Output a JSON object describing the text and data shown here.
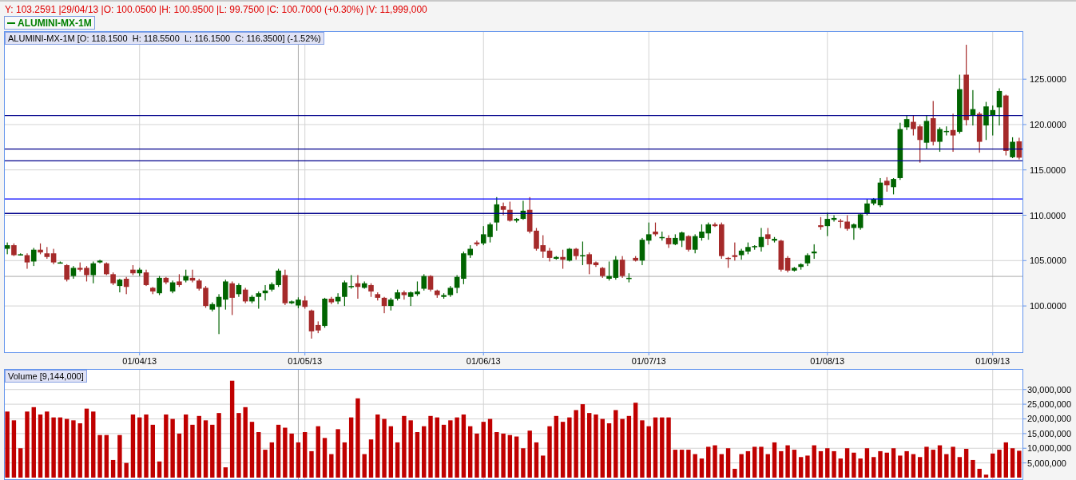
{
  "status_line": "Y: 103.2591 |29/04/13 |O: 100.0500 |H: 100.9500 |L: 99.7500 |C: 100.7000 (+0.30%) |V: 11,999,000",
  "legend": {
    "label": "ALUMINI-MX-1M"
  },
  "price_panel": {
    "info_label": "ALUMINI-MX-1M [O: 118.1500  H: 118.5500  L: 116.1500  C: 116.3500] (-1.52%)",
    "chart_data": {
      "type": "candlestick",
      "grid": true,
      "ylim": [
        94.9,
        130.3
      ],
      "categories": [
        null,
        null,
        null,
        null,
        null,
        null,
        null,
        null,
        null,
        null,
        null,
        null,
        null,
        null,
        null,
        null,
        null,
        null,
        null,
        null,
        "01/04/13",
        null,
        null,
        null,
        null,
        null,
        null,
        null,
        null,
        null,
        null,
        null,
        null,
        null,
        null,
        null,
        null,
        null,
        null,
        null,
        null,
        null,
        null,
        null,
        null,
        "01/05/13",
        null,
        null,
        null,
        null,
        null,
        null,
        null,
        null,
        null,
        null,
        null,
        null,
        null,
        null,
        null,
        null,
        null,
        null,
        null,
        null,
        null,
        null,
        null,
        null,
        null,
        null,
        "01/06/13",
        null,
        null,
        null,
        null,
        null,
        null,
        null,
        null,
        null,
        null,
        null,
        null,
        null,
        null,
        null,
        null,
        null,
        null,
        null,
        null,
        null,
        null,
        null,
        null,
        "01/07/13",
        null,
        null,
        null,
        null,
        null,
        null,
        null,
        null,
        null,
        null,
        null,
        null,
        null,
        null,
        null,
        null,
        null,
        null,
        null,
        null,
        null,
        null,
        null,
        null,
        null,
        null,
        "01/08/13",
        null,
        null,
        null,
        null,
        null,
        null,
        null,
        null,
        null,
        null,
        null,
        null,
        null,
        null,
        null,
        null,
        null,
        null,
        null,
        null,
        null,
        null,
        null,
        null,
        "01/09/13",
        null,
        null,
        null,
        null
      ],
      "yticks": [
        {
          "value": 100,
          "label": "100.0000"
        },
        {
          "value": 105,
          "label": "105.0000"
        },
        {
          "value": 110,
          "label": "110.0000"
        },
        {
          "value": 115,
          "label": "115.0000"
        },
        {
          "value": 120,
          "label": "120.0000"
        },
        {
          "value": 125,
          "label": "125.0000"
        }
      ],
      "ohlc": [
        [
          106.3,
          107.0,
          105.7,
          106.7
        ],
        [
          106.7,
          106.9,
          105.5,
          105.6
        ],
        [
          105.7,
          105.8,
          105.6,
          105.7
        ],
        [
          105.6,
          105.8,
          104.1,
          104.8
        ],
        [
          104.9,
          106.4,
          104.4,
          106.2
        ],
        [
          106.2,
          106.9,
          105.7,
          105.9
        ],
        [
          105.8,
          106.5,
          105.2,
          105.4
        ],
        [
          105.8,
          106.3,
          104.6,
          104.8
        ],
        [
          104.8,
          104.9,
          104.7,
          104.8
        ],
        [
          104.5,
          104.6,
          102.7,
          102.9
        ],
        [
          103.3,
          104.4,
          103.0,
          104.2
        ],
        [
          104.2,
          104.8,
          103.8,
          104.0
        ],
        [
          104.2,
          104.4,
          102.7,
          103.4
        ],
        [
          103.4,
          104.9,
          102.5,
          104.7
        ],
        [
          104.8,
          105.1,
          104.7,
          105.0
        ],
        [
          104.7,
          104.8,
          103.4,
          103.5
        ],
        [
          103.5,
          103.7,
          102.3,
          102.5
        ],
        [
          102.2,
          103.0,
          101.5,
          102.9
        ],
        [
          103.0,
          103.2,
          101.3,
          102.1
        ],
        [
          104.0,
          104.5,
          103.4,
          103.6
        ],
        [
          103.6,
          104.2,
          103.3,
          104.0
        ],
        [
          103.7,
          104.0,
          102.2,
          102.3
        ],
        [
          102.0,
          102.1,
          101.3,
          101.6
        ],
        [
          101.4,
          103.3,
          101.2,
          103.1
        ],
        [
          103.1,
          103.2,
          102.4,
          102.6
        ],
        [
          101.6,
          102.8,
          101.4,
          102.6
        ],
        [
          102.7,
          103.5,
          102.1,
          102.3
        ],
        [
          102.8,
          104.0,
          102.6,
          103.3
        ],
        [
          103.1,
          104.0,
          102.6,
          102.8
        ],
        [
          102.8,
          103.0,
          101.7,
          101.9
        ],
        [
          102.0,
          102.2,
          99.8,
          100.0
        ],
        [
          99.6,
          100.4,
          99.4,
          100.2
        ],
        [
          99.9,
          101.3,
          96.9,
          101.0
        ],
        [
          100.7,
          102.9,
          99.6,
          102.7
        ],
        [
          102.5,
          102.7,
          99.0,
          100.9
        ],
        [
          101.3,
          102.5,
          101.0,
          102.3
        ],
        [
          101.8,
          102.0,
          100.3,
          100.5
        ],
        [
          100.5,
          101.2,
          100.3,
          101.0
        ],
        [
          101.0,
          101.6,
          99.7,
          101.4
        ],
        [
          101.4,
          102.3,
          100.6,
          101.7
        ],
        [
          101.8,
          102.6,
          101.6,
          102.4
        ],
        [
          102.3,
          104.1,
          102.1,
          103.9
        ],
        [
          103.4,
          104.0,
          100.1,
          100.3
        ],
        [
          100.3,
          100.6,
          100.2,
          100.5
        ],
        [
          100.05,
          100.95,
          99.75,
          100.7
        ],
        [
          100.6,
          101.1,
          99.7,
          99.9
        ],
        [
          99.5,
          99.6,
          96.4,
          97.2
        ],
        [
          97.9,
          98.3,
          97.0,
          97.3
        ],
        [
          97.8,
          100.9,
          97.6,
          100.8
        ],
        [
          100.8,
          101.0,
          100.2,
          100.4
        ],
        [
          100.5,
          101.4,
          100.2,
          101.0
        ],
        [
          101.0,
          102.8,
          100.0,
          102.6
        ],
        [
          102.2,
          103.4,
          101.9,
          102.2
        ],
        [
          102.5,
          103.4,
          100.8,
          102.1
        ],
        [
          102.0,
          102.7,
          101.9,
          102.5
        ],
        [
          102.3,
          102.5,
          101.0,
          101.6
        ],
        [
          101.3,
          101.5,
          100.6,
          100.9
        ],
        [
          100.9,
          101.0,
          99.2,
          100.0
        ],
        [
          100.0,
          100.9,
          99.5,
          100.7
        ],
        [
          100.8,
          101.8,
          100.6,
          101.5
        ],
        [
          101.5,
          101.7,
          100.7,
          101.2
        ],
        [
          101.0,
          101.6,
          100.0,
          101.5
        ],
        [
          101.3,
          102.7,
          101.1,
          101.6
        ],
        [
          101.9,
          103.5,
          101.7,
          103.3
        ],
        [
          103.3,
          103.4,
          101.6,
          101.8
        ],
        [
          101.7,
          101.8,
          100.9,
          101.2
        ],
        [
          101.0,
          101.4,
          100.8,
          101.2
        ],
        [
          101.2,
          102.2,
          101.0,
          102.0
        ],
        [
          102.0,
          103.4,
          101.4,
          103.2
        ],
        [
          103.0,
          106.0,
          102.4,
          105.8
        ],
        [
          105.6,
          106.7,
          105.3,
          106.3
        ],
        [
          107.0,
          107.2,
          106.6,
          106.8
        ],
        [
          106.9,
          108.8,
          106.7,
          107.9
        ],
        [
          107.6,
          109.2,
          107.0,
          109.0
        ],
        [
          109.2,
          112.0,
          108.3,
          111.2
        ],
        [
          111.0,
          111.4,
          110.0,
          110.6
        ],
        [
          110.6,
          111.5,
          109.3,
          109.4
        ],
        [
          109.4,
          109.7,
          109.2,
          109.6
        ],
        [
          109.6,
          111.6,
          109.5,
          110.5
        ],
        [
          110.6,
          112.0,
          108.0,
          108.2
        ],
        [
          108.3,
          108.6,
          106.1,
          106.3
        ],
        [
          106.7,
          107.8,
          105.3,
          106.0
        ],
        [
          106.1,
          106.4,
          104.9,
          105.3
        ],
        [
          105.2,
          105.5,
          105.1,
          105.4
        ],
        [
          105.4,
          106.2,
          104.1,
          105.1
        ],
        [
          105.0,
          106.4,
          104.9,
          106.3
        ],
        [
          106.3,
          106.4,
          105.1,
          105.5
        ],
        [
          105.6,
          107.1,
          104.5,
          105.6
        ],
        [
          105.7,
          105.9,
          103.5,
          104.6
        ],
        [
          104.8,
          104.9,
          104.3,
          104.5
        ],
        [
          104.2,
          104.3,
          103.1,
          103.3
        ],
        [
          103.0,
          104.9,
          102.8,
          103.3
        ],
        [
          103.1,
          105.5,
          102.9,
          105.1
        ],
        [
          105.1,
          105.5,
          103.1,
          103.3
        ],
        [
          103.1,
          103.6,
          102.6,
          103.1
        ],
        [
          105.3,
          105.5,
          104.9,
          105.0
        ],
        [
          105.0,
          107.5,
          104.5,
          107.3
        ],
        [
          107.2,
          109.2,
          106.8,
          107.9
        ],
        [
          108.2,
          109.2,
          107.7,
          107.9
        ],
        [
          107.6,
          108.2,
          107.2,
          107.6
        ],
        [
          107.5,
          107.8,
          106.4,
          106.8
        ],
        [
          106.8,
          107.9,
          106.7,
          107.5
        ],
        [
          107.2,
          108.2,
          106.5,
          108.1
        ],
        [
          107.7,
          107.8,
          106.0,
          106.2
        ],
        [
          106.2,
          107.9,
          105.8,
          107.7
        ],
        [
          107.5,
          109.0,
          107.2,
          108.2
        ],
        [
          108.0,
          109.2,
          107.3,
          109.0
        ],
        [
          109.0,
          109.2,
          108.7,
          108.8
        ],
        [
          109.0,
          109.2,
          105.2,
          105.5
        ],
        [
          105.3,
          105.4,
          104.2,
          105.2
        ],
        [
          105.6,
          107.0,
          105.0,
          105.4
        ],
        [
          105.6,
          106.3,
          105.1,
          106.1
        ],
        [
          106.0,
          107.0,
          105.7,
          106.5
        ],
        [
          106.5,
          106.7,
          106.2,
          106.6
        ],
        [
          106.5,
          108.6,
          106.0,
          107.6
        ],
        [
          107.9,
          108.6,
          106.7,
          107.4
        ],
        [
          107.2,
          107.6,
          107.0,
          107.4
        ],
        [
          107.2,
          107.3,
          103.8,
          104.0
        ],
        [
          105.3,
          105.5,
          103.7,
          103.9
        ],
        [
          103.9,
          104.3,
          103.8,
          104.2
        ],
        [
          104.3,
          104.7,
          104.0,
          104.6
        ],
        [
          104.7,
          105.8,
          104.4,
          105.6
        ],
        [
          105.8,
          106.8,
          105.2,
          106.0
        ],
        [
          108.9,
          109.8,
          108.4,
          108.7
        ],
        [
          108.8,
          110.3,
          107.7,
          109.6
        ],
        [
          109.5,
          110.0,
          109.3,
          109.7
        ],
        [
          109.4,
          109.6,
          108.6,
          109.3
        ],
        [
          109.3,
          110.0,
          108.3,
          108.5
        ],
        [
          108.6,
          109.1,
          107.3,
          109.0
        ],
        [
          108.6,
          110.2,
          108.4,
          110.1
        ],
        [
          110.2,
          111.8,
          110.0,
          111.3
        ],
        [
          111.3,
          111.9,
          111.1,
          111.8
        ],
        [
          111.1,
          114.1,
          110.9,
          113.6
        ],
        [
          113.8,
          114.2,
          112.6,
          113.3
        ],
        [
          113.1,
          114.1,
          112.3,
          114.0
        ],
        [
          114.1,
          120.2,
          113.9,
          119.5
        ],
        [
          119.7,
          121.0,
          119.4,
          120.6
        ],
        [
          120.3,
          121.0,
          118.8,
          119.5
        ],
        [
          119.8,
          120.0,
          115.8,
          118.3
        ],
        [
          118.0,
          121.0,
          117.3,
          120.4
        ],
        [
          120.7,
          122.6,
          117.7,
          118.1
        ],
        [
          118.1,
          119.7,
          117.0,
          119.5
        ],
        [
          119.3,
          119.8,
          118.8,
          119.3
        ],
        [
          119.4,
          121.2,
          117.0,
          118.8
        ],
        [
          119.2,
          125.5,
          119.0,
          123.9
        ],
        [
          125.5,
          128.8,
          119.9,
          120.5
        ],
        [
          121.0,
          123.8,
          119.9,
          121.7
        ],
        [
          121.2,
          121.4,
          116.9,
          118.1
        ],
        [
          119.9,
          122.5,
          118.3,
          122.0
        ],
        [
          121.0,
          122.1,
          118.8,
          121.6
        ],
        [
          121.9,
          124.0,
          119.9,
          123.7
        ],
        [
          123.2,
          123.3,
          116.6,
          117.1
        ],
        [
          116.4,
          118.6,
          116.3,
          118.1
        ],
        [
          118.15,
          118.55,
          116.15,
          116.35
        ]
      ],
      "ref_lines": [
        {
          "axis": "y",
          "value": 121.0,
          "color": "#00008b"
        },
        {
          "axis": "y",
          "value": 117.3,
          "color": "#00008b"
        },
        {
          "axis": "y",
          "value": 116.0,
          "color": "#00008b"
        },
        {
          "axis": "y",
          "value": 111.8,
          "color": "#0000ff"
        },
        {
          "axis": "y",
          "value": 110.2,
          "color": "#00008b"
        },
        {
          "axis": "y",
          "value": 103.2591,
          "color": "#a9a9a9"
        }
      ]
    }
  },
  "volume_panel": {
    "info_label": "Volume [9,144,000]",
    "chart_data": {
      "type": "bar",
      "grid": true,
      "ylim": [
        0,
        37000000
      ],
      "yticks": [
        {
          "value": 5000000,
          "label": "5,000,000"
        },
        {
          "value": 10000000,
          "label": "10,000,000"
        },
        {
          "value": 15000000,
          "label": "15,000,000"
        },
        {
          "value": 20000000,
          "label": "20,000,000"
        },
        {
          "value": 25000000,
          "label": "25,000,000"
        },
        {
          "value": 30000000,
          "label": "30,000,000"
        }
      ],
      "series": [
        {
          "color": "#c00000",
          "values": [
            22500000,
            19500000,
            10000000,
            22500000,
            24000000,
            21500000,
            22500000,
            20500000,
            20500000,
            20000000,
            19500000,
            18500000,
            23500000,
            22500000,
            14500000,
            14500000,
            6000000,
            14500000,
            5000000,
            21500000,
            20500000,
            21500000,
            18000000,
            5500000,
            21500000,
            20000000,
            15000000,
            21500000,
            18000000,
            21000000,
            19500000,
            18000000,
            22000000,
            3500000,
            33000000,
            22000000,
            24000000,
            19000000,
            15500000,
            9500000,
            12000000,
            18000000,
            17000000,
            15000000,
            11999000,
            15500000,
            9000000,
            17500000,
            13500000,
            8000000,
            16500000,
            12000000,
            20500000,
            27000000,
            8000000,
            13000000,
            21500000,
            20000000,
            17500000,
            12000000,
            21000000,
            19500000,
            15500000,
            17500000,
            21000000,
            20500000,
            18000000,
            19500000,
            20500000,
            21500000,
            17500000,
            15000000,
            19000000,
            20000000,
            15500000,
            15000000,
            14500000,
            14000000,
            10000000,
            16000000,
            12000000,
            7500000,
            17500000,
            21000000,
            19000000,
            20500000,
            23000000,
            25000000,
            22000000,
            21500000,
            20000000,
            18500000,
            23000000,
            20000000,
            21000000,
            25500000,
            19500000,
            17500000,
            20500000,
            20500000,
            20500000,
            9500000,
            9500000,
            9500000,
            8000000,
            6500000,
            10500000,
            11000000,
            8000000,
            10000000,
            3000000,
            8000000,
            9000000,
            10500000,
            10500000,
            8000000,
            12000000,
            9000000,
            11000000,
            9500000,
            7000000,
            7500000,
            11000000,
            9000000,
            10000000,
            9000000,
            6500000,
            10000000,
            8500000,
            6500000,
            10000000,
            7000000,
            9000000,
            8500000,
            10000000,
            7500000,
            9000000,
            8000000,
            7000000,
            10500000,
            9500000,
            11000000,
            8000000,
            10500000,
            7000000,
            9800000,
            6000000,
            3000000,
            1000000,
            8200000,
            9500000,
            12000000,
            10000000,
            9144000
          ]
        }
      ]
    }
  }
}
